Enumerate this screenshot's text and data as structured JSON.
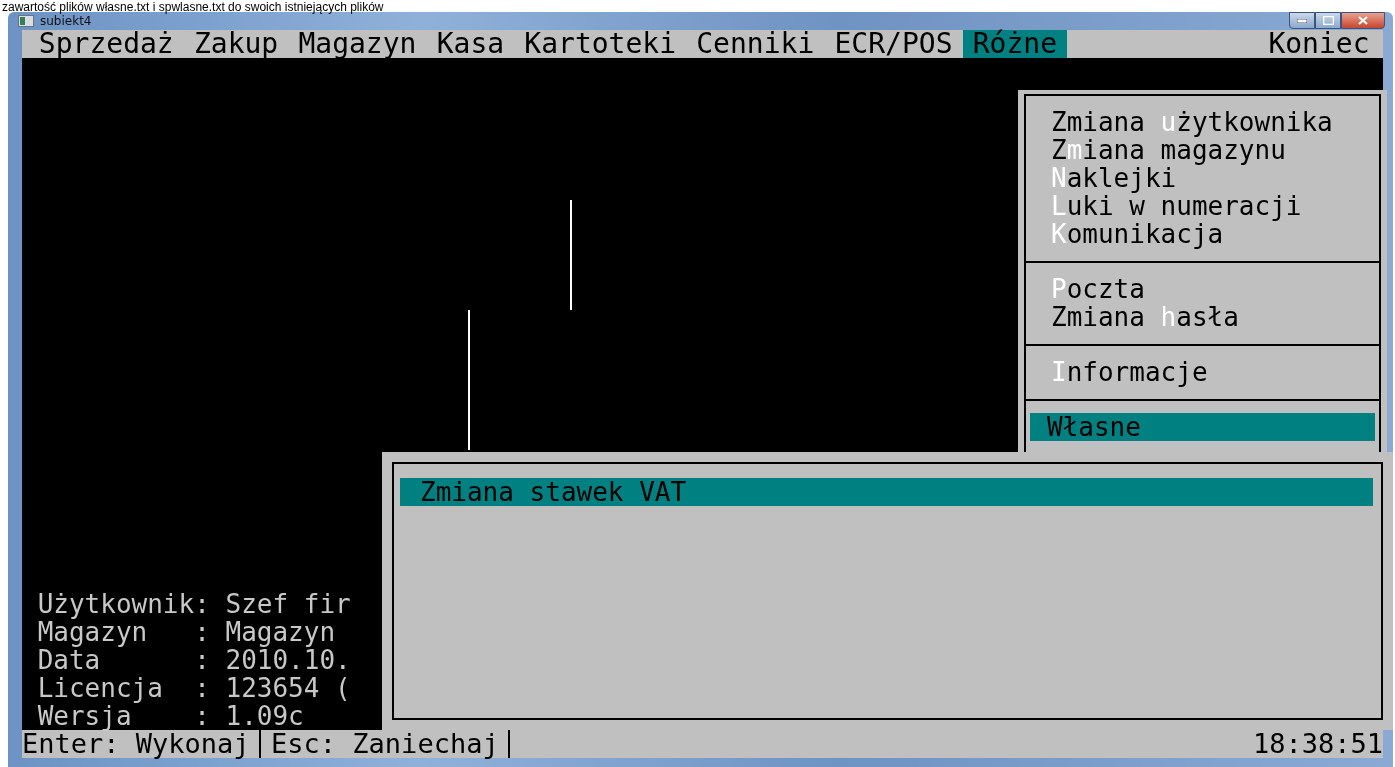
{
  "caption": "zawartość plików własne.txt i spwlasne.txt do swoich istniejących plików",
  "window": {
    "title": "subiekt4"
  },
  "menu_bar": [
    {
      "label": "Sprzedaż",
      "selected": false
    },
    {
      "label": "Zakup",
      "selected": false
    },
    {
      "label": "Magazyn",
      "selected": false
    },
    {
      "label": "Kasa",
      "selected": false
    },
    {
      "label": "Kartoteki",
      "selected": false
    },
    {
      "label": "Cenniki",
      "selected": false
    },
    {
      "label": "ECR/POS",
      "selected": false
    },
    {
      "label": "Różne",
      "selected": true
    },
    {
      "label": "Koniec",
      "selected": false
    }
  ],
  "dropdown": {
    "groups": [
      {
        "items": [
          {
            "label_start": "Zmiana ",
            "hotkey": "u",
            "label_end": "żytkownika",
            "selected": false
          },
          {
            "label_start": "Z",
            "hotkey": "m",
            "label_end": "iana magazynu",
            "selected": false
          },
          {
            "hotkey": "N",
            "label_end": "aklejki",
            "selected": false
          },
          {
            "hotkey": "L",
            "label_end": "uki w numeracji",
            "selected": false
          },
          {
            "hotkey": "K",
            "label_end": "omunikacja",
            "selected": false
          }
        ]
      },
      {
        "items": [
          {
            "hotkey": "P",
            "label_end": "oczta",
            "selected": false
          },
          {
            "label_start": "Zmiana ",
            "hotkey": "h",
            "label_end": "asła",
            "selected": false
          }
        ]
      },
      {
        "items": [
          {
            "hotkey": "I",
            "label_end": "nformacje",
            "selected": false
          }
        ]
      },
      {
        "items": [
          {
            "label_start": "Własne",
            "selected": true
          }
        ]
      }
    ]
  },
  "submenu": {
    "items": [
      {
        "label": "Zmiana stawek VAT",
        "selected": true
      }
    ]
  },
  "info_lines": [
    "Użytkownik: Szef fir",
    "Magazyn   : Magazyn",
    "Data      : 2010.10.",
    "Licencja  : 123654 (",
    "Wersja    : 1.09c"
  ],
  "status_bar": {
    "hints": [
      "Enter: Wykonaj",
      "Esc: Zaniechaj"
    ],
    "clock": "18:38:51"
  }
}
